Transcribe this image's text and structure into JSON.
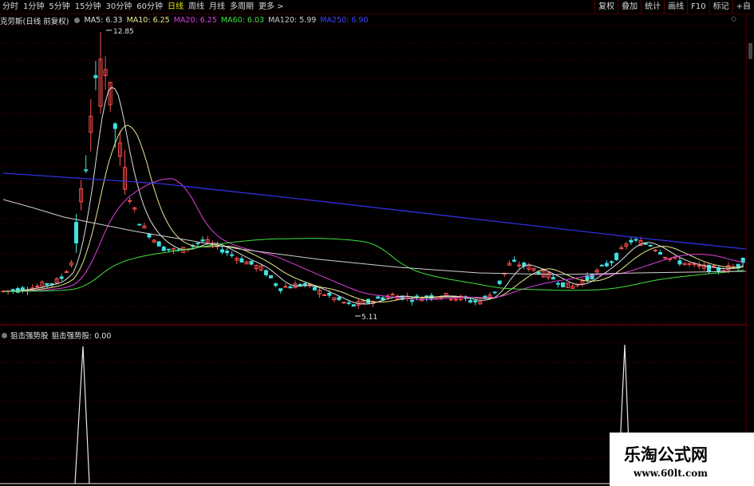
{
  "toolbar": {
    "tabs": [
      {
        "label": "分时"
      },
      {
        "label": "1分钟"
      },
      {
        "label": "5分钟"
      },
      {
        "label": "15分钟"
      },
      {
        "label": "30分钟"
      },
      {
        "label": "60分钟"
      },
      {
        "label": "日线",
        "active": true
      },
      {
        "label": "周线"
      },
      {
        "label": "月线"
      },
      {
        "label": "多周期"
      },
      {
        "label": "更多 >"
      }
    ],
    "right": [
      {
        "label": "复权"
      },
      {
        "label": "叠加"
      },
      {
        "label": "统计"
      },
      {
        "label": "画线"
      },
      {
        "label": "F10"
      },
      {
        "label": "标记"
      },
      {
        "label": "+自"
      }
    ]
  },
  "chart_info": {
    "stock": "克劳斯(日线 前复权)",
    "ma": [
      {
        "text": "MA5: 6.33",
        "color": "#e0e0e0"
      },
      {
        "text": "MA10: 6.25",
        "color": "#e8e890"
      },
      {
        "text": "MA20: 6.25",
        "color": "#e040e0"
      },
      {
        "text": "MA60: 6.03",
        "color": "#40e040"
      },
      {
        "text": "MA120: 5.99",
        "color": "#d0d0d0"
      },
      {
        "text": "MA250: 6.90",
        "color": "#4040ff"
      }
    ],
    "high_label": "12.85",
    "low_label": "5.11"
  },
  "indicator": {
    "name": "狙击强势股",
    "value_text": "狙击强势股: 0.00"
  },
  "colors": {
    "up": "#ff5050",
    "down": "#40e0e0",
    "grid": "#6a0000"
  },
  "watermark": {
    "main": "乐淘公式网",
    "url": "www.60lt.com"
  }
}
